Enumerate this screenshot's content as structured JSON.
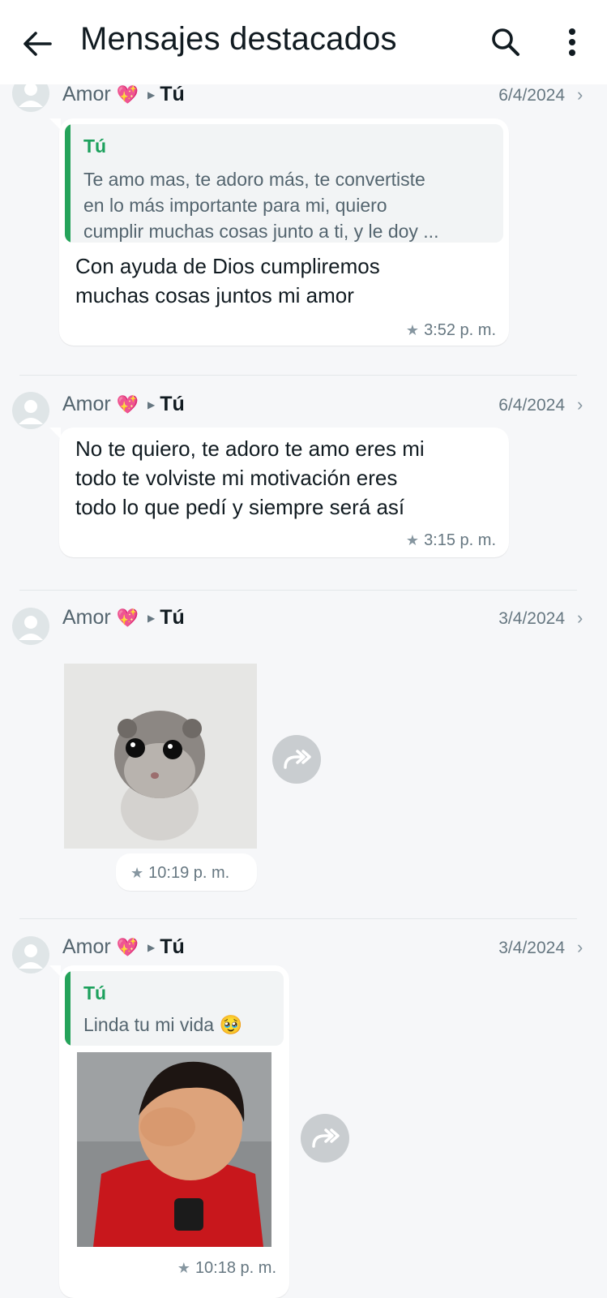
{
  "appbar": {
    "title": "Mensajes destacados",
    "back_icon": "arrow-left-icon",
    "search_icon": "search-icon",
    "more_icon": "more-vertical-icon"
  },
  "entries": [
    {
      "sender": "Amor",
      "heart": "💖",
      "recipient": "Tú",
      "date": "6/4/2024",
      "quote_author": "Tú",
      "quote_lines": [
        "Te amo mas, te adoro más, te convertiste",
        "en lo más importante para mi, quiero",
        "cumplir muchas cosas junto a ti, y le doy ..."
      ],
      "message_lines": [
        "Con ayuda de Dios cumpliremos",
        "muchas cosas juntos mi amor"
      ],
      "time": "3:52 p. m."
    },
    {
      "sender": "Amor",
      "heart": "💖",
      "recipient": "Tú",
      "date": "6/4/2024",
      "message_lines": [
        "No te quiero, te adoro te amo eres mi",
        "todo te volviste mi motivación eres",
        "todo lo que pedí y siempre será así"
      ],
      "time": "3:15 p. m."
    },
    {
      "sender": "Amor",
      "heart": "💖",
      "recipient": "Tú",
      "date": "3/4/2024",
      "image": "hamster-sticker",
      "time": "10:19 p. m."
    },
    {
      "sender": "Amor",
      "heart": "💖",
      "recipient": "Tú",
      "date": "3/4/2024",
      "quote_author": "Tú",
      "quote_text": "Linda tu mi vida",
      "quote_emoji": "🥹",
      "image": "laughing-boy-photo",
      "time": "10:18 p. m."
    }
  ],
  "colors": {
    "accent_green": "#25a35a",
    "background": "#f6f7f9",
    "bubble": "#ffffff"
  }
}
